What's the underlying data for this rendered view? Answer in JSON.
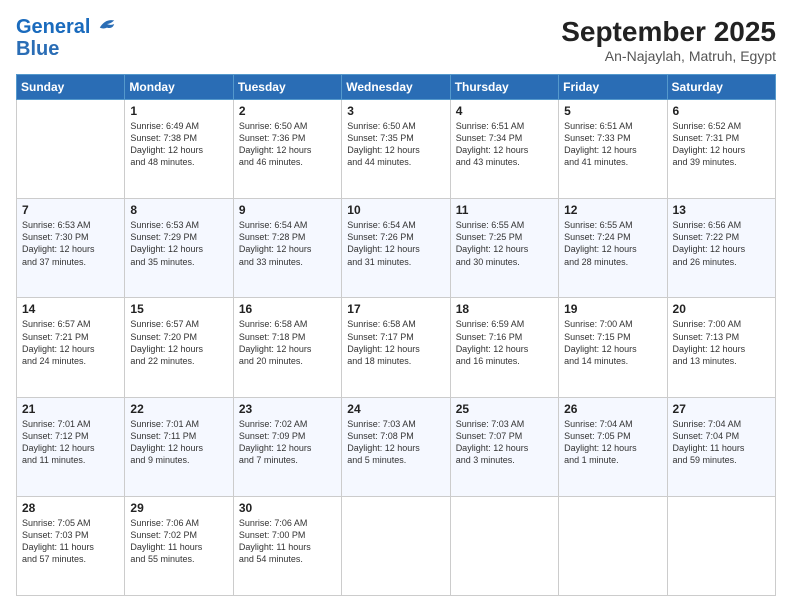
{
  "logo": {
    "line1": "General",
    "line2": "Blue"
  },
  "title": "September 2025",
  "subtitle": "An-Najaylah, Matruh, Egypt",
  "days_header": [
    "Sunday",
    "Monday",
    "Tuesday",
    "Wednesday",
    "Thursday",
    "Friday",
    "Saturday"
  ],
  "weeks": [
    [
      {
        "num": "",
        "info": ""
      },
      {
        "num": "1",
        "info": "Sunrise: 6:49 AM\nSunset: 7:38 PM\nDaylight: 12 hours\nand 48 minutes."
      },
      {
        "num": "2",
        "info": "Sunrise: 6:50 AM\nSunset: 7:36 PM\nDaylight: 12 hours\nand 46 minutes."
      },
      {
        "num": "3",
        "info": "Sunrise: 6:50 AM\nSunset: 7:35 PM\nDaylight: 12 hours\nand 44 minutes."
      },
      {
        "num": "4",
        "info": "Sunrise: 6:51 AM\nSunset: 7:34 PM\nDaylight: 12 hours\nand 43 minutes."
      },
      {
        "num": "5",
        "info": "Sunrise: 6:51 AM\nSunset: 7:33 PM\nDaylight: 12 hours\nand 41 minutes."
      },
      {
        "num": "6",
        "info": "Sunrise: 6:52 AM\nSunset: 7:31 PM\nDaylight: 12 hours\nand 39 minutes."
      }
    ],
    [
      {
        "num": "7",
        "info": "Sunrise: 6:53 AM\nSunset: 7:30 PM\nDaylight: 12 hours\nand 37 minutes."
      },
      {
        "num": "8",
        "info": "Sunrise: 6:53 AM\nSunset: 7:29 PM\nDaylight: 12 hours\nand 35 minutes."
      },
      {
        "num": "9",
        "info": "Sunrise: 6:54 AM\nSunset: 7:28 PM\nDaylight: 12 hours\nand 33 minutes."
      },
      {
        "num": "10",
        "info": "Sunrise: 6:54 AM\nSunset: 7:26 PM\nDaylight: 12 hours\nand 31 minutes."
      },
      {
        "num": "11",
        "info": "Sunrise: 6:55 AM\nSunset: 7:25 PM\nDaylight: 12 hours\nand 30 minutes."
      },
      {
        "num": "12",
        "info": "Sunrise: 6:55 AM\nSunset: 7:24 PM\nDaylight: 12 hours\nand 28 minutes."
      },
      {
        "num": "13",
        "info": "Sunrise: 6:56 AM\nSunset: 7:22 PM\nDaylight: 12 hours\nand 26 minutes."
      }
    ],
    [
      {
        "num": "14",
        "info": "Sunrise: 6:57 AM\nSunset: 7:21 PM\nDaylight: 12 hours\nand 24 minutes."
      },
      {
        "num": "15",
        "info": "Sunrise: 6:57 AM\nSunset: 7:20 PM\nDaylight: 12 hours\nand 22 minutes."
      },
      {
        "num": "16",
        "info": "Sunrise: 6:58 AM\nSunset: 7:18 PM\nDaylight: 12 hours\nand 20 minutes."
      },
      {
        "num": "17",
        "info": "Sunrise: 6:58 AM\nSunset: 7:17 PM\nDaylight: 12 hours\nand 18 minutes."
      },
      {
        "num": "18",
        "info": "Sunrise: 6:59 AM\nSunset: 7:16 PM\nDaylight: 12 hours\nand 16 minutes."
      },
      {
        "num": "19",
        "info": "Sunrise: 7:00 AM\nSunset: 7:15 PM\nDaylight: 12 hours\nand 14 minutes."
      },
      {
        "num": "20",
        "info": "Sunrise: 7:00 AM\nSunset: 7:13 PM\nDaylight: 12 hours\nand 13 minutes."
      }
    ],
    [
      {
        "num": "21",
        "info": "Sunrise: 7:01 AM\nSunset: 7:12 PM\nDaylight: 12 hours\nand 11 minutes."
      },
      {
        "num": "22",
        "info": "Sunrise: 7:01 AM\nSunset: 7:11 PM\nDaylight: 12 hours\nand 9 minutes."
      },
      {
        "num": "23",
        "info": "Sunrise: 7:02 AM\nSunset: 7:09 PM\nDaylight: 12 hours\nand 7 minutes."
      },
      {
        "num": "24",
        "info": "Sunrise: 7:03 AM\nSunset: 7:08 PM\nDaylight: 12 hours\nand 5 minutes."
      },
      {
        "num": "25",
        "info": "Sunrise: 7:03 AM\nSunset: 7:07 PM\nDaylight: 12 hours\nand 3 minutes."
      },
      {
        "num": "26",
        "info": "Sunrise: 7:04 AM\nSunset: 7:05 PM\nDaylight: 12 hours\nand 1 minute."
      },
      {
        "num": "27",
        "info": "Sunrise: 7:04 AM\nSunset: 7:04 PM\nDaylight: 11 hours\nand 59 minutes."
      }
    ],
    [
      {
        "num": "28",
        "info": "Sunrise: 7:05 AM\nSunset: 7:03 PM\nDaylight: 11 hours\nand 57 minutes."
      },
      {
        "num": "29",
        "info": "Sunrise: 7:06 AM\nSunset: 7:02 PM\nDaylight: 11 hours\nand 55 minutes."
      },
      {
        "num": "30",
        "info": "Sunrise: 7:06 AM\nSunset: 7:00 PM\nDaylight: 11 hours\nand 54 minutes."
      },
      {
        "num": "",
        "info": ""
      },
      {
        "num": "",
        "info": ""
      },
      {
        "num": "",
        "info": ""
      },
      {
        "num": "",
        "info": ""
      }
    ]
  ]
}
